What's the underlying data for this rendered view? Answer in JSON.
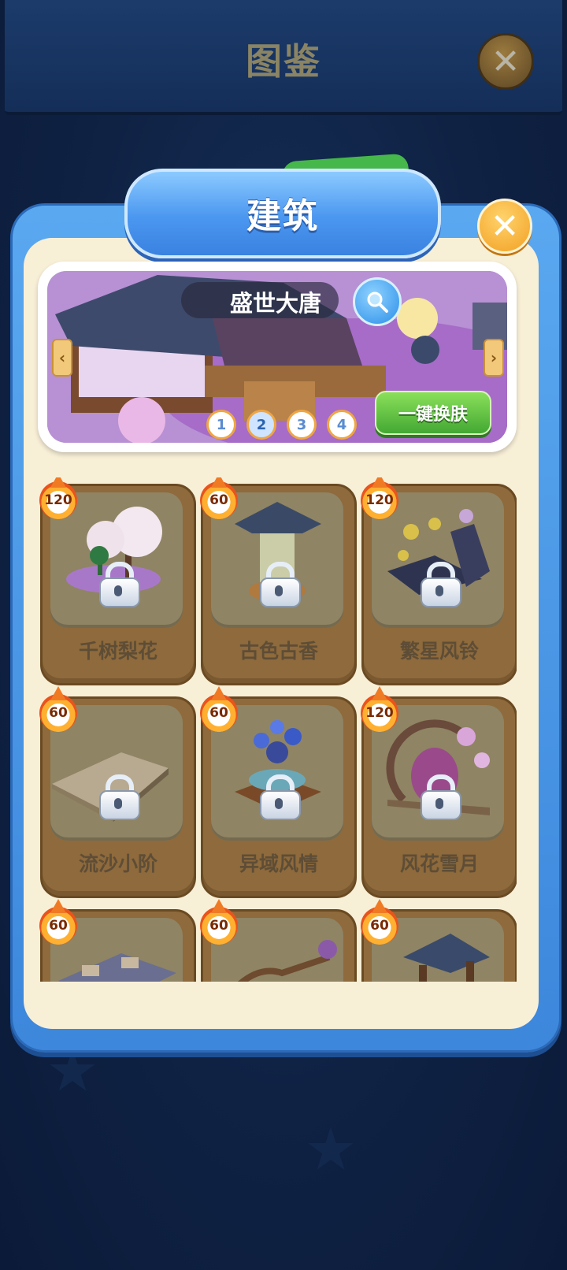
{
  "top_bar": {
    "title": "图鉴"
  },
  "panel": {
    "title": "建筑",
    "banner": {
      "title": "盛世大唐",
      "pages": [
        "1",
        "2",
        "3",
        "4"
      ],
      "active_page": 2,
      "skin_button": "一键换肤",
      "nav_left": "‹",
      "nav_right": "›"
    },
    "items": [
      {
        "name": "千树梨花",
        "badge": "120",
        "locked": true
      },
      {
        "name": "古色古香",
        "badge": "60",
        "locked": true
      },
      {
        "name": "繁星风铃",
        "badge": "120",
        "locked": true
      },
      {
        "name": "流沙小阶",
        "badge": "60",
        "locked": true
      },
      {
        "name": "异域风情",
        "badge": "60",
        "locked": true
      },
      {
        "name": "风花雪月",
        "badge": "120",
        "locked": true
      },
      {
        "name": "",
        "badge": "60",
        "locked": true
      },
      {
        "name": "",
        "badge": "60",
        "locked": true
      },
      {
        "name": "",
        "badge": "60",
        "locked": true
      }
    ]
  },
  "colors": {
    "background": "#0f2244",
    "panel_blue": "#4a97f0",
    "panel_cream": "#f8efd7",
    "card_brown": "#8e6a3c",
    "accent_orange": "#f2a024",
    "button_green": "#43a833"
  },
  "icons": {
    "top_close": "close-icon",
    "panel_close": "close-icon",
    "search": "magnifier-icon",
    "lock": "padlock-icon",
    "badge": "flame-icon"
  }
}
